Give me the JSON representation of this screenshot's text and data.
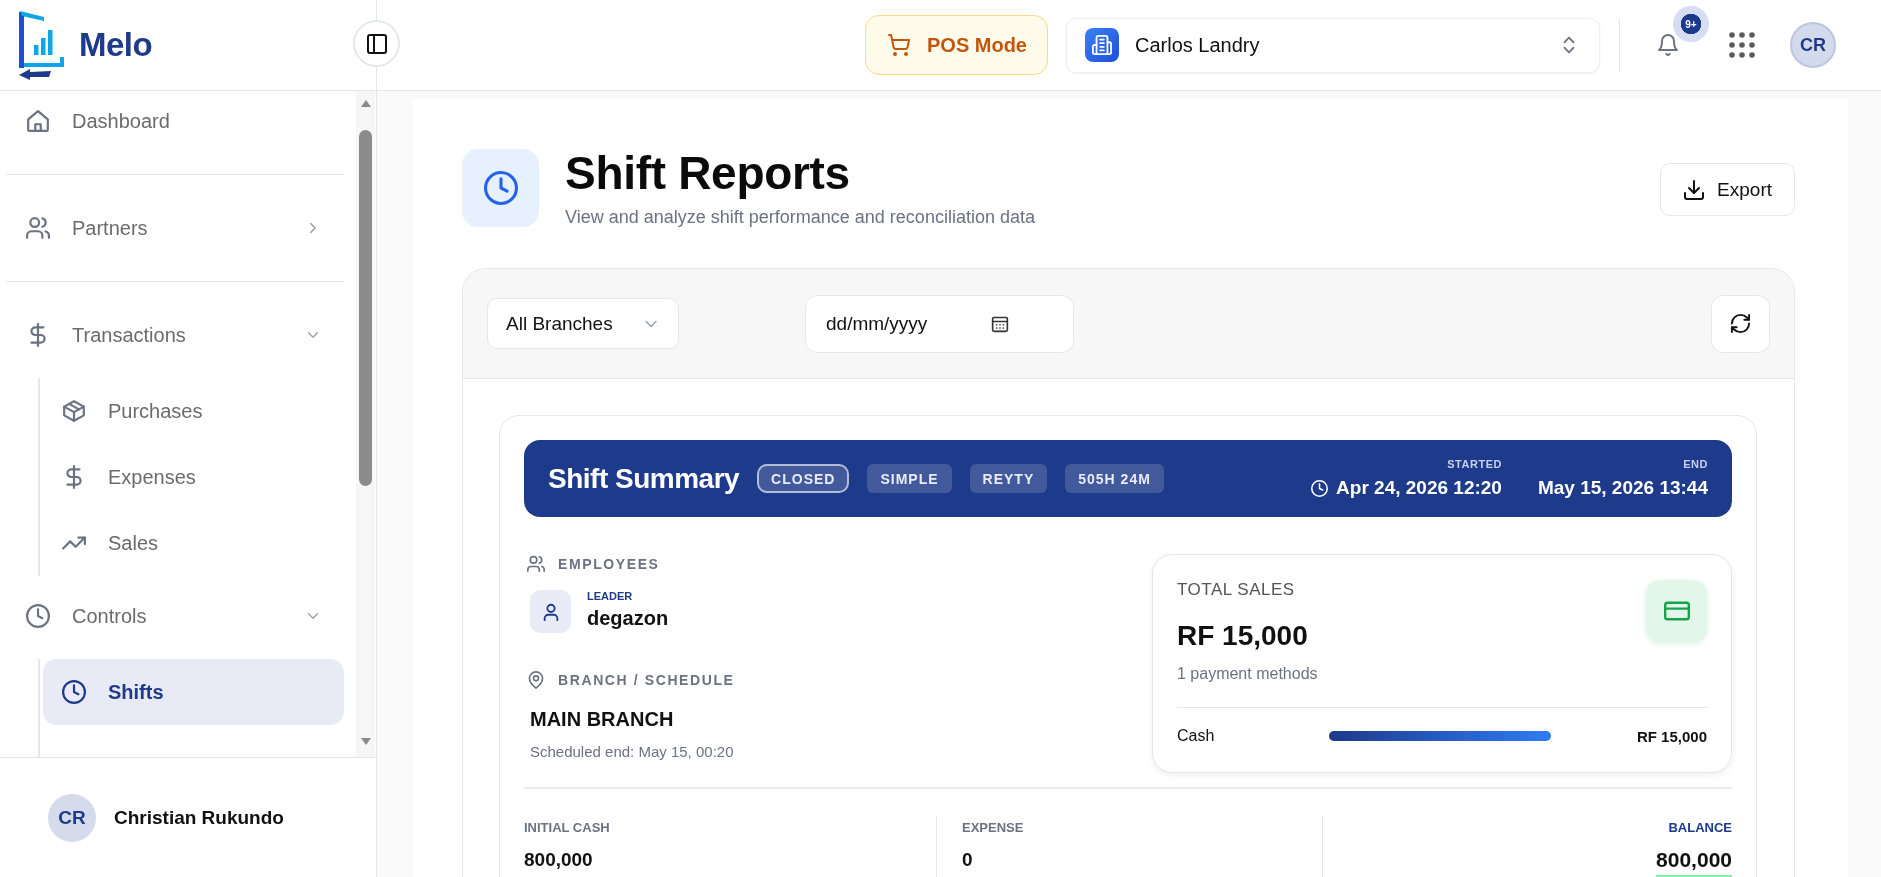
{
  "app": {
    "name": "Melo"
  },
  "topbar": {
    "pos_button": {
      "label": "POS Mode"
    },
    "branch_selector": {
      "value": "Carlos Landry"
    },
    "notifications": {
      "badge": "9+"
    },
    "user": {
      "initials": "CR"
    }
  },
  "sidebar": {
    "sections": [
      {
        "items": [
          {
            "label": "Dashboard",
            "selected": false
          }
        ]
      },
      {
        "items": [
          {
            "label": "Partners",
            "selected": false,
            "expanded": false
          }
        ]
      },
      {
        "items": [
          {
            "label": "Transactions",
            "selected": false,
            "expanded": true,
            "children": [
              {
                "label": "Purchases",
                "selected": false
              },
              {
                "label": "Expenses",
                "selected": false
              },
              {
                "label": "Sales",
                "selected": false
              }
            ]
          },
          {
            "label": "Controls",
            "selected": false,
            "expanded": true,
            "children": [
              {
                "label": "Shifts",
                "selected": true
              }
            ]
          }
        ]
      }
    ],
    "user": {
      "initials": "CR",
      "name": "Christian Rukundo"
    }
  },
  "page_header": {
    "title": "Shift Reports",
    "subtitle": "View and analyze shift performance and reconciliation data",
    "export_button": "Export"
  },
  "filters": {
    "branch_select": {
      "value": "All Branches"
    },
    "date_field": {
      "placeholder": "dd/mm/yyyy"
    }
  },
  "shift_summary": {
    "title": "Shift Summary",
    "badges": [
      {
        "label": "CLOSED",
        "kind": "status"
      },
      {
        "label": "SIMPLE",
        "kind": "tag"
      },
      {
        "label": "REYTY",
        "kind": "tag"
      },
      {
        "label": "505H 24M",
        "kind": "tag"
      }
    ],
    "times": [
      {
        "label": "STARTED",
        "value": "Apr 24, 2026 12:20",
        "kind": "start"
      },
      {
        "label": "END",
        "value": "May 15, 2026 13:44",
        "kind": "end"
      }
    ],
    "employees": {
      "heading": "EMPLOYEES",
      "members": [
        {
          "role": "LEADER",
          "name": "degazon"
        }
      ]
    },
    "branch": {
      "heading": "BRANCH / SCHEDULE",
      "name": "MAIN BRANCH",
      "note": "Scheduled end: May 15, 00:20"
    },
    "total_sales": {
      "label": "TOTAL SALES",
      "amount": "RF 15,000",
      "caption": "1 payment methods",
      "methods": [
        {
          "name": "Cash",
          "level": 1,
          "amount": "RF 15,000"
        }
      ]
    },
    "totals": [
      {
        "label": "INITIAL CASH",
        "value": "800,000",
        "kind": "plain"
      },
      {
        "label": "EXPENSE",
        "value": "0",
        "kind": "plain"
      },
      {
        "label": "BALANCE",
        "value": "800,000",
        "kind": "balance"
      }
    ]
  }
}
